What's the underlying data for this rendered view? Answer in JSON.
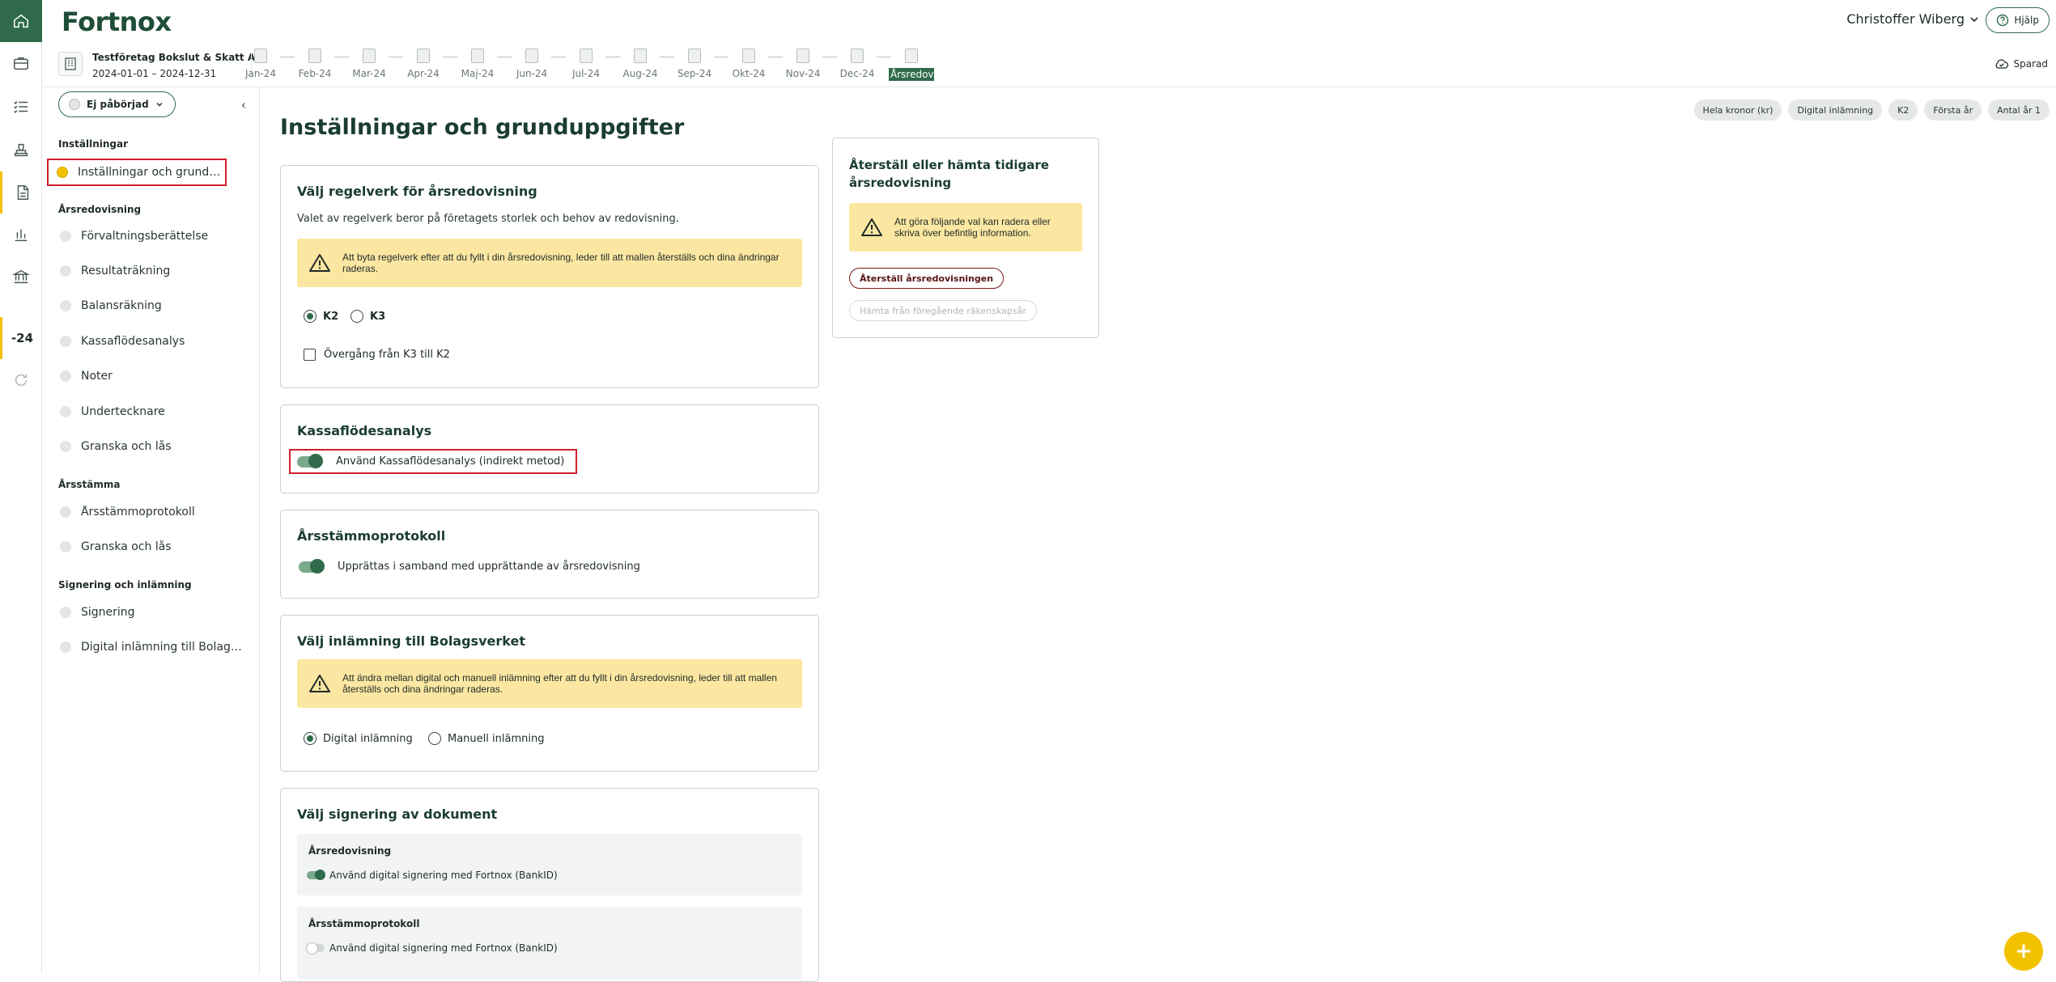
{
  "header": {
    "logo": "Fortnox",
    "user_name": "Christoffer Wiberg",
    "help_label": "Hjälp",
    "saved_label": "Sparad"
  },
  "company": {
    "name": "Testföretag Bokslut & Skatt AB",
    "period": "2024-01-01 – 2024-12-31"
  },
  "timeline": {
    "months": [
      "Jan-24",
      "Feb-24",
      "Mar-24",
      "Apr-24",
      "Maj-24",
      "Jun-24",
      "Jul-24",
      "Aug-24",
      "Sep-24",
      "Okt-24",
      "Nov-24",
      "Dec-24",
      "Årsredovisning"
    ],
    "active_index": 12
  },
  "rail": {
    "year_label": "-24"
  },
  "sidebar": {
    "status_label": "Ej påbörjad",
    "sections": [
      {
        "title": "Inställningar",
        "items": [
          "Inställningar och grunduppgifter"
        ]
      },
      {
        "title": "Årsredovisning",
        "items": [
          "Förvaltningsberättelse",
          "Resultaträkning",
          "Balansräkning",
          "Kassaflödesanalys",
          "Noter",
          "Undertecknare",
          "Granska och lås"
        ]
      },
      {
        "title": "Årsstämma",
        "items": [
          "Årsstämmoprotokoll",
          "Granska och lås"
        ]
      },
      {
        "title": "Signering och inlämning",
        "items": [
          "Signering",
          "Digital inlämning till Bolagsverket"
        ]
      }
    ]
  },
  "main": {
    "title": "Inställningar och grunduppgifter",
    "regelverk": {
      "title": "Välj regelverk för årsredovisning",
      "text": "Valet av regelverk beror på företagets storlek och behov av redovisning.",
      "warning": "Att byta regelverk efter att du fyllt i din årsredovisning, leder till att mallen återställs och dina ändringar raderas.",
      "option_k2": "K2",
      "option_k3": "K3",
      "checkbox": "Övergång från K3 till K2"
    },
    "kassaflode": {
      "title": "Kassaflödesanalys",
      "toggle": "Använd Kassaflödesanalys (indirekt metod)"
    },
    "arsstamma": {
      "title": "Årsstämmoprotokoll",
      "toggle": "Upprättas i samband med upprättande av årsredovisning"
    },
    "inlamning": {
      "title": "Välj inlämning till Bolagsverket",
      "warning": "Att ändra mellan digital och manuell inlämning efter att du fyllt i din årsredovisning, leder till att mallen återställs och dina ändringar raderas.",
      "option_digital": "Digital inlämning",
      "option_manual": "Manuell inlämning"
    },
    "signering": {
      "title": "Välj signering av dokument",
      "sub1_title": "Årsredovisning",
      "sub1_toggle": "Använd digital signering med Fortnox (BankID)",
      "sub2_title": "Årsstämmoprotokoll",
      "sub2_toggle": "Använd digital signering med Fortnox (BankID)"
    }
  },
  "restore": {
    "title": "Återställ eller hämta tidigare årsredovisning",
    "warning": "Att göra följande val kan radera eller skriva över befintlig information.",
    "restore_button": "Återställ årsredovisningen",
    "fetch_button": "Hämta från föregående räkenskapsår"
  },
  "chips": [
    "Hela kronor (kr)",
    "Digital inlämning",
    "K2",
    "Första år",
    "Antal år 1"
  ],
  "colors": {
    "brand_green": "#2f6b4a",
    "warning_bg": "#fbe7a1",
    "highlight_red": "#d0202a",
    "fab_yellow": "#f2c200"
  }
}
